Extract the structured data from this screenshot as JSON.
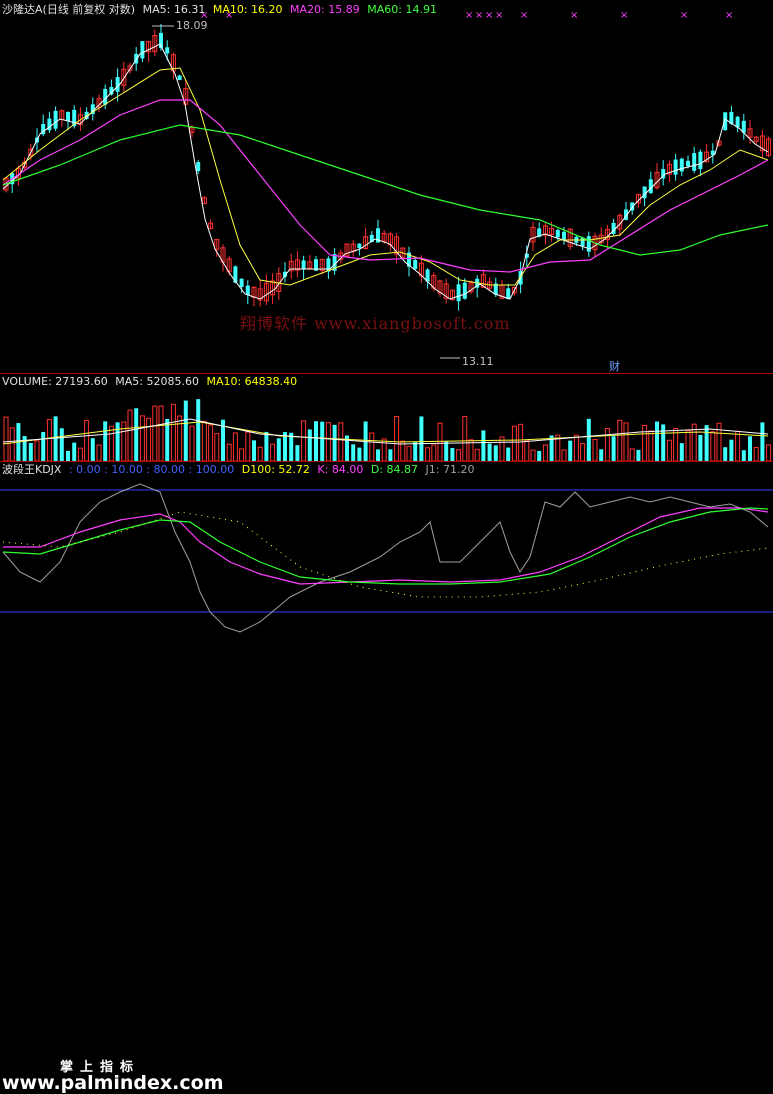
{
  "price_legend": {
    "title": "沙隆达A(日线 前复权 对数)",
    "ma5": "MA5: 16.31",
    "ma10": "MA10: 16.20",
    "ma20": "MA20: 15.89",
    "ma60": "MA60: 14.91"
  },
  "price_labels": {
    "high": "18.09",
    "low": "13.11"
  },
  "watermark": "翔博软件 www.xiangbosoft.com",
  "fin_mark": "财",
  "volume_legend": {
    "title": "VOLUME: 27193.60",
    "ma5": "MA5: 52085.60",
    "ma10": "MA10: 64838.40"
  },
  "kdj_legend": {
    "title": "波段王KDJX",
    "levels": ": 0.00 : 10.00 : 80.00 : 100.00",
    "d100": "D100: 52.72",
    "k": "K: 84.00",
    "d": "D: 84.87",
    "j1": "J1: 71.20"
  },
  "brand": {
    "cn": "掌上指标",
    "url": "www.palmindex.com"
  },
  "colors": {
    "up": "#ff3030",
    "down": "#40ffff",
    "ma5": "#ffff40",
    "ma10": "#ffffff",
    "ma20": "#ff40ff",
    "ma60": "#30ff30",
    "separator": "#b00000",
    "reference_line": "#3040ff"
  }
}
